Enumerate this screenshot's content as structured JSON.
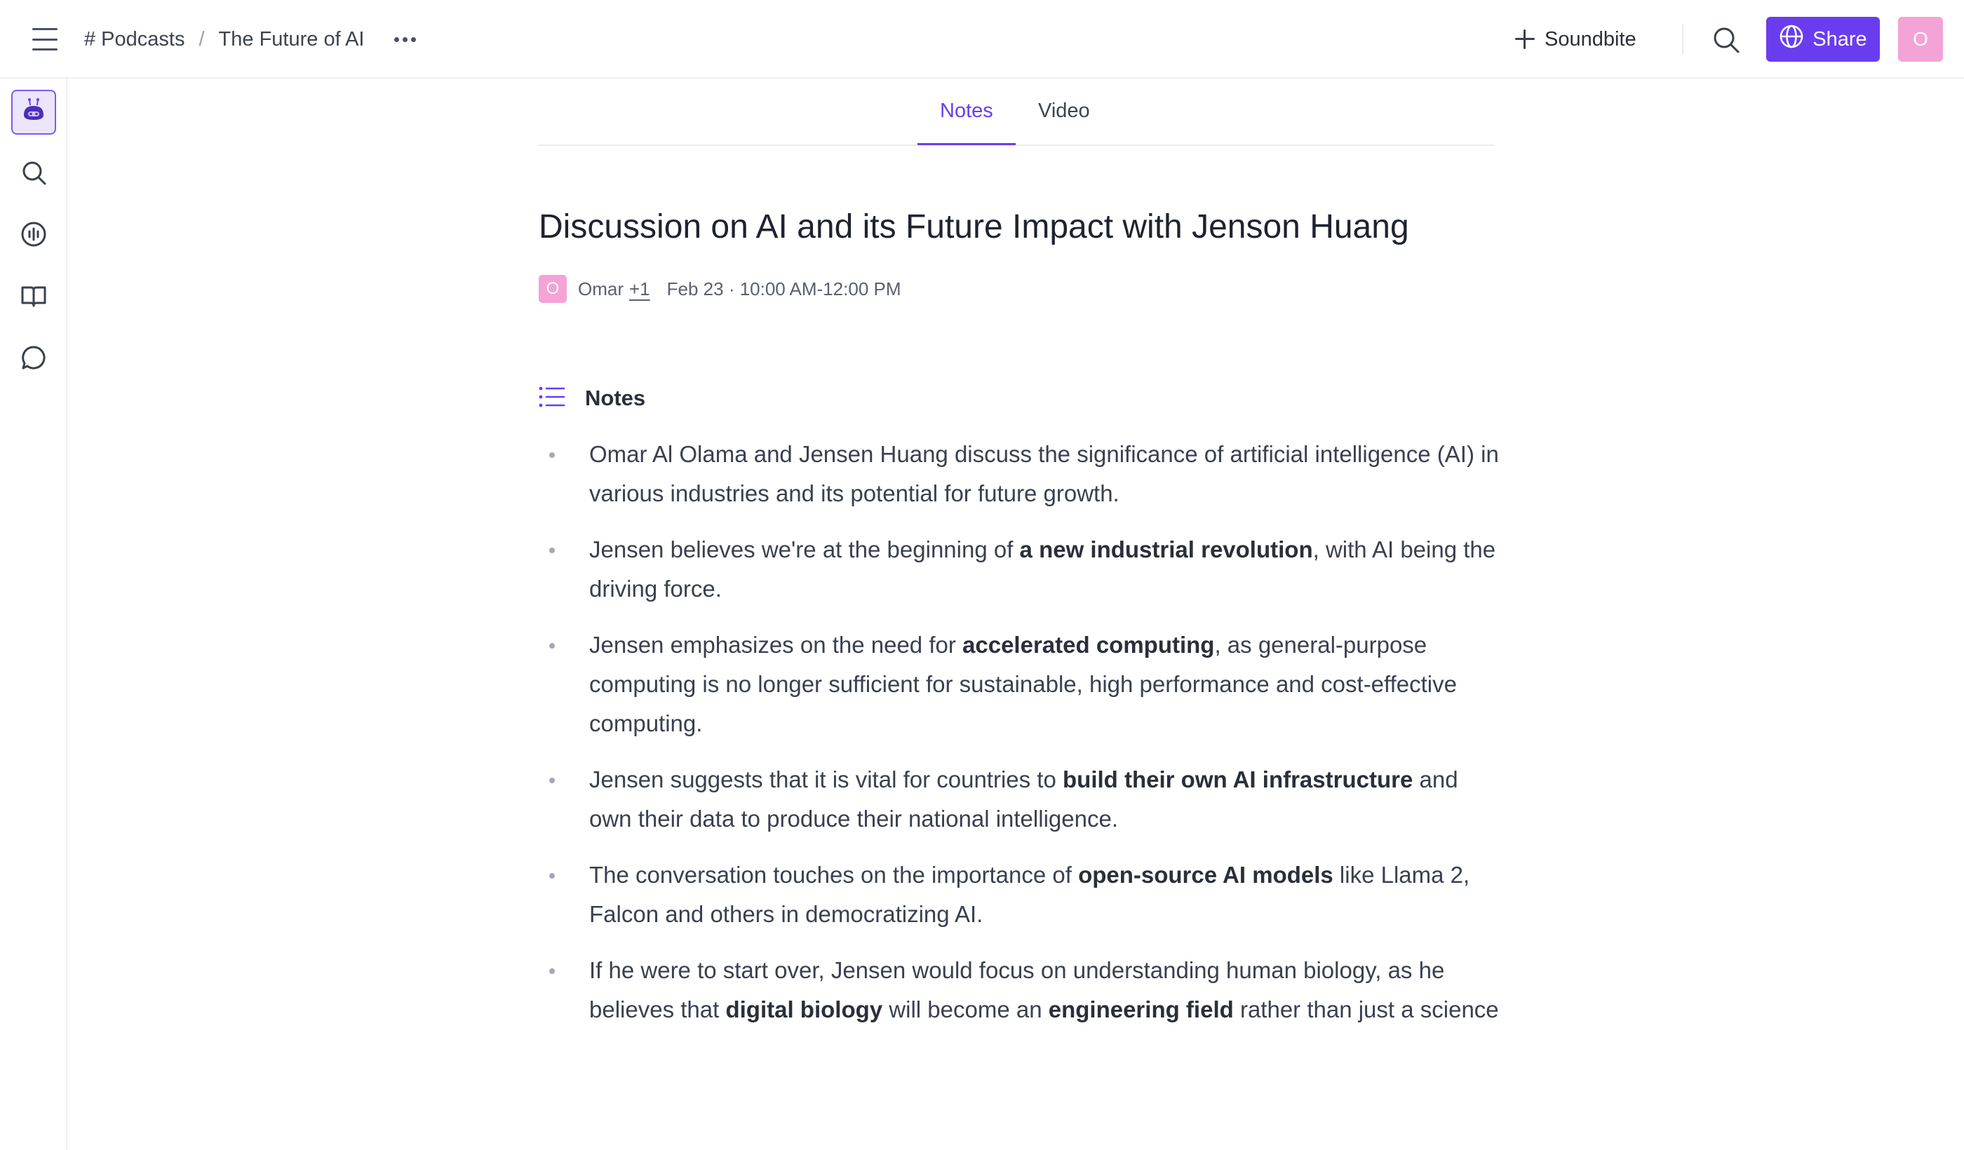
{
  "header": {
    "breadcrumb": [
      "# Podcasts",
      "The Future of AI"
    ],
    "breadcrumb_separator": "/",
    "soundbite_label": "Soundbite",
    "share_label": "Share",
    "user_initial": "O"
  },
  "sidebar": {
    "items": [
      {
        "icon": "bot-icon",
        "active": true
      },
      {
        "icon": "search-icon",
        "active": false
      },
      {
        "icon": "audio-icon",
        "active": false
      },
      {
        "icon": "book-icon",
        "active": false
      },
      {
        "icon": "chat-icon",
        "active": false
      }
    ]
  },
  "tabs": [
    {
      "label": "Notes",
      "active": true
    },
    {
      "label": "Video",
      "active": false
    }
  ],
  "document": {
    "title": "Discussion on AI and its Future Impact with Jenson Huang",
    "author_initial": "O",
    "author": "Omar",
    "extra_participants": "+1",
    "datetime": "Feb 23 · 10:00 AM-12:00 PM"
  },
  "notes": {
    "heading": "Notes",
    "items": [
      [
        {
          "t": "Omar Al Olama and Jensen Huang discuss the significance of artificial intelligence (AI) in various industries and its potential for future growth.",
          "b": false
        }
      ],
      [
        {
          "t": "Jensen believes we're at the beginning of ",
          "b": false
        },
        {
          "t": "a new industrial revolution",
          "b": true
        },
        {
          "t": ", with AI being the driving force.",
          "b": false
        }
      ],
      [
        {
          "t": "Jensen emphasizes on the need for ",
          "b": false
        },
        {
          "t": "accelerated computing",
          "b": true
        },
        {
          "t": ", as general-purpose computing is no longer sufficient for sustainable, high performance and cost-effective computing.",
          "b": false
        }
      ],
      [
        {
          "t": "Jensen suggests that it is vital for countries to ",
          "b": false
        },
        {
          "t": "build their own AI infrastructure",
          "b": true
        },
        {
          "t": " and own their data to produce their national intelligence.",
          "b": false
        }
      ],
      [
        {
          "t": "The conversation touches on the importance of ",
          "b": false
        },
        {
          "t": "open-source AI models",
          "b": true
        },
        {
          "t": " like Llama 2, Falcon and others in democratizing AI.",
          "b": false
        }
      ],
      [
        {
          "t": "If he were to start over, Jensen would focus on understanding human biology, as he believes that ",
          "b": false
        },
        {
          "t": "digital biology",
          "b": true
        },
        {
          "t": " will become an ",
          "b": false
        },
        {
          "t": "engineering field",
          "b": true
        },
        {
          "t": " rather than just a science",
          "b": false
        }
      ]
    ]
  },
  "colors": {
    "accent": "#6a3cf0",
    "avatar": "#f4a3d6"
  }
}
